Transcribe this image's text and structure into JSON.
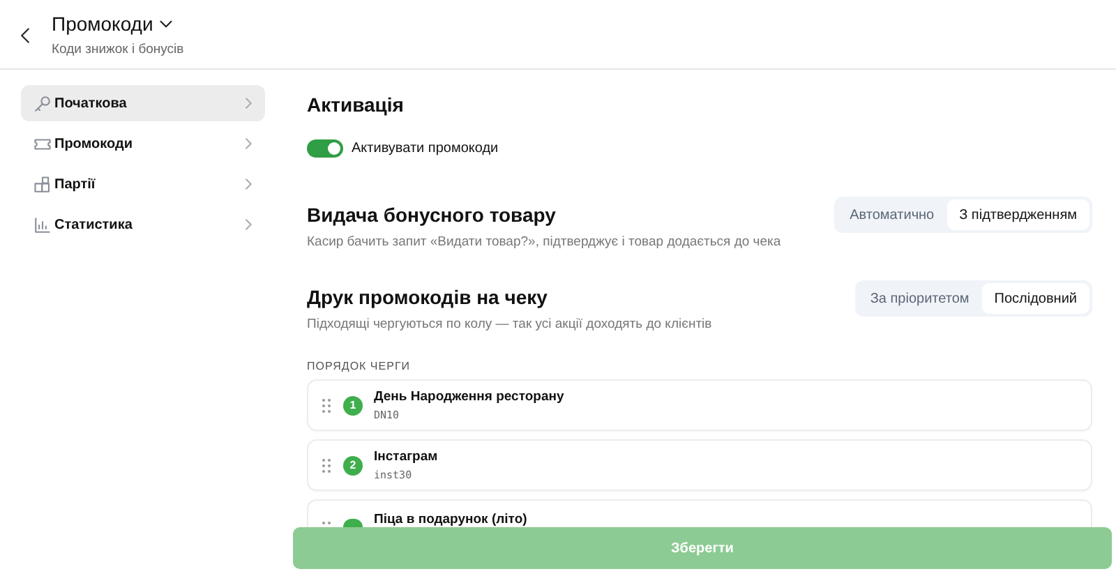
{
  "header": {
    "title": "Промокоди",
    "subtitle": "Коди знижок і бонусів"
  },
  "sidebar": {
    "items": [
      {
        "label": "Початкова",
        "kind": "key",
        "selected": true
      },
      {
        "label": "Промокоди",
        "kind": "ticket",
        "selected": false
      },
      {
        "label": "Партії",
        "kind": "boxes",
        "selected": false
      },
      {
        "label": "Статистика",
        "kind": "chart",
        "selected": false
      }
    ]
  },
  "activation": {
    "title": "Активація",
    "toggle": {
      "label": "Активувати промокоди",
      "on": true
    }
  },
  "bonus": {
    "title": "Видача бонусного товару",
    "description": "Касир бачить запит «Видати товар?», підтверджує і товар додається до чека",
    "options": [
      {
        "label": "Автоматично",
        "selected": false
      },
      {
        "label": "З підтвердженням",
        "selected": true
      }
    ]
  },
  "printing": {
    "title": "Друк промокодів на чеку",
    "description": "Підходящі чергуються по колу — так усі акції доходять до клієнтів",
    "options": [
      {
        "label": "За пріоритетом",
        "selected": false
      },
      {
        "label": "Послідовний",
        "selected": true
      }
    ]
  },
  "queue": {
    "heading": "ПОРЯДОК ЧЕРГИ",
    "items": [
      {
        "number": "1",
        "name": "День Народження ресторану",
        "code": "DN10"
      },
      {
        "number": "2",
        "name": "Інстаграм",
        "code": "inst30"
      },
      {
        "name": "Піца в подарунок (літо)"
      }
    ]
  },
  "save_button": {
    "label": "Зберегти",
    "disabled": true
  }
}
